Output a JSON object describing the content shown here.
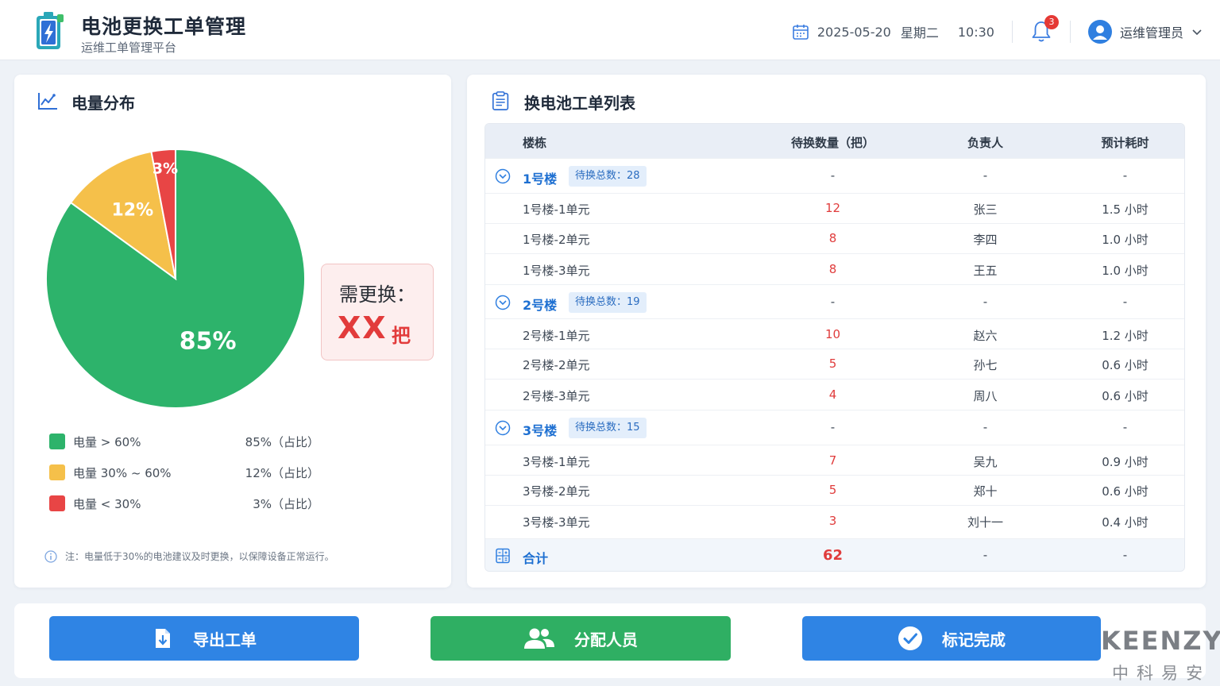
{
  "header": {
    "title": "电池更换工单管理",
    "subtitle": "运维工单管理平台",
    "date": "2025-05-20",
    "weekday": "星期二",
    "time": "10:30",
    "notification_count": "3",
    "user": "运维管理员"
  },
  "left_panel": {
    "title": "电量分布",
    "callout_label": "需更换：",
    "callout_value": "XX",
    "callout_unit": "把",
    "legend": [
      {
        "name": "电量 > 60%",
        "pct": "85%（占比）",
        "color": "#2db36b"
      },
      {
        "name": "电量 30% ~ 60%",
        "pct": "12%（占比）",
        "color": "#f5c04a"
      },
      {
        "name": "电量 < 30%",
        "pct": "3%（占比）",
        "color": "#e84545"
      }
    ],
    "note": "注：电量低于30%的电池建议及时更换，以保障设备正常运行。"
  },
  "chart_data": {
    "type": "pie",
    "categories": [
      "电量 > 60%",
      "电量 30% ~ 60%",
      "电量 < 30%"
    ],
    "values": [
      85,
      12,
      3
    ],
    "labels": [
      "85%",
      "12%",
      "3%"
    ],
    "colors": [
      "#2db36b",
      "#f5c04a",
      "#e84545"
    ]
  },
  "right_panel": {
    "title": "换电池工单列表",
    "columns": [
      "楼栋",
      "待换数量（把）",
      "负责人",
      "预计耗时"
    ],
    "groups": [
      {
        "name": "1号楼",
        "badge": "待换总数：28",
        "qty": "-",
        "owner": "-",
        "time": "-",
        "rows": [
          {
            "name": "1号楼-1单元",
            "qty": "12",
            "owner": "张三",
            "time": "1.5 小时"
          },
          {
            "name": "1号楼-2单元",
            "qty": "8",
            "owner": "李四",
            "time": "1.0 小时"
          },
          {
            "name": "1号楼-3单元",
            "qty": "8",
            "owner": "王五",
            "time": "1.0 小时"
          }
        ]
      },
      {
        "name": "2号楼",
        "badge": "待换总数：19",
        "qty": "-",
        "owner": "-",
        "time": "-",
        "rows": [
          {
            "name": "2号楼-1单元",
            "qty": "10",
            "owner": "赵六",
            "time": "1.2 小时"
          },
          {
            "name": "2号楼-2单元",
            "qty": "5",
            "owner": "孙七",
            "time": "0.6 小时"
          },
          {
            "name": "2号楼-3单元",
            "qty": "4",
            "owner": "周八",
            "time": "0.6 小时"
          }
        ]
      },
      {
        "name": "3号楼",
        "badge": "待换总数：15",
        "qty": "-",
        "owner": "-",
        "time": "-",
        "rows": [
          {
            "name": "3号楼-1单元",
            "qty": "7",
            "owner": "吴九",
            "time": "0.9 小时"
          },
          {
            "name": "3号楼-2单元",
            "qty": "5",
            "owner": "郑十",
            "time": "0.6 小时"
          },
          {
            "name": "3号楼-3单元",
            "qty": "3",
            "owner": "刘十一",
            "time": "0.4 小时"
          }
        ]
      }
    ],
    "total": {
      "label": "合计",
      "qty": "62",
      "owner": "-",
      "time": "-"
    }
  },
  "actions": {
    "export": "导出工单",
    "assign": "分配人员",
    "done": "标记完成"
  },
  "watermark": {
    "en": "KEENZY",
    "cn": "中科易安"
  }
}
